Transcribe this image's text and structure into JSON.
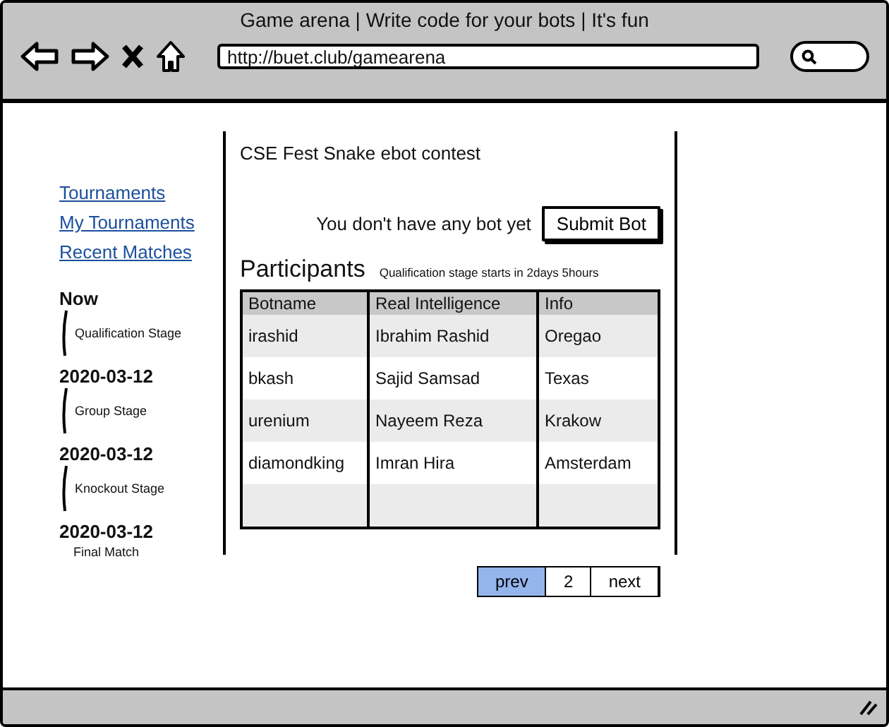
{
  "window": {
    "title": "Game arena | Write code for your bots | It's fun",
    "url": "http://buet.club/gamearena"
  },
  "sidebar": {
    "links": [
      {
        "label": "Tournaments"
      },
      {
        "label": "My Tournaments"
      },
      {
        "label": "Recent Matches"
      }
    ],
    "timeline": [
      {
        "kind": "milestone",
        "text": "Now"
      },
      {
        "kind": "stage",
        "text": "Qualification Stage"
      },
      {
        "kind": "milestone",
        "text": "2020-03-12"
      },
      {
        "kind": "stage",
        "text": "Group Stage"
      },
      {
        "kind": "milestone",
        "text": "2020-03-12"
      },
      {
        "kind": "stage",
        "text": "Knockout Stage"
      },
      {
        "kind": "milestone",
        "text": "2020-03-12"
      },
      {
        "kind": "final",
        "text": "Final Match"
      }
    ]
  },
  "contest": {
    "title": "CSE Fest Snake ebot contest",
    "bot_message": "You don't have any bot yet",
    "submit_button": "Submit Bot",
    "participants_heading": "Participants",
    "countdown": "Qualification stage starts in 2days 5hours"
  },
  "table": {
    "columns": [
      "Botname",
      "Real Intelligence",
      "Info"
    ],
    "rows": [
      [
        "irashid",
        "Ibrahim Rashid",
        "Oregao"
      ],
      [
        "bkash",
        "Sajid Samsad",
        "Texas"
      ],
      [
        "urenium",
        "Nayeem Reza",
        "Krakow"
      ],
      [
        "diamondking",
        "Imran Hira",
        "Amsterdam"
      ]
    ]
  },
  "pagination": [
    {
      "label": "prev",
      "selected": true
    },
    {
      "label": "2",
      "selected": false
    },
    {
      "label": "next",
      "selected": false
    }
  ]
}
